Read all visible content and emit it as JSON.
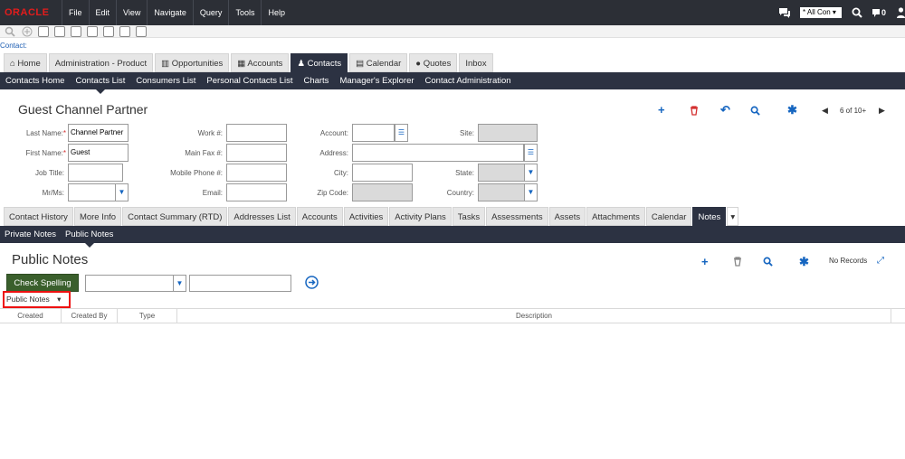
{
  "app": {
    "logo": "ORACLE",
    "menu": [
      "File",
      "Edit",
      "View",
      "Navigate",
      "Query",
      "Tools",
      "Help"
    ],
    "search_scope": "* All Con",
    "notification_count": "0"
  },
  "context_label": "Contact:",
  "screen_tabs": [
    {
      "label": "Home",
      "icon": "home-icon"
    },
    {
      "label": "Administration - Product"
    },
    {
      "label": "Opportunities",
      "icon": "bar-chart-icon"
    },
    {
      "label": "Accounts",
      "icon": "building-icon"
    },
    {
      "label": "Contacts",
      "icon": "person-icon",
      "active": true
    },
    {
      "label": "Calendar",
      "icon": "calendar-icon"
    },
    {
      "label": "Quotes",
      "icon": "quote-icon"
    },
    {
      "label": "Inbox"
    }
  ],
  "view_nav": [
    "Contacts Home",
    "Contacts List",
    "Consumers List",
    "Personal Contacts List",
    "Charts",
    "Manager's Explorer",
    "Contact Administration"
  ],
  "form": {
    "title": "Guest Channel Partner",
    "record_counter": "6 of 10+",
    "fields": {
      "last_name": {
        "label": "Last Name:",
        "value": "Channel Partner"
      },
      "first_name": {
        "label": "First Name:",
        "value": "Guest"
      },
      "job_title": {
        "label": "Job Title:",
        "value": ""
      },
      "mr_ms": {
        "label": "Mr/Ms:",
        "value": ""
      },
      "work_phone": {
        "label": "Work #:",
        "value": ""
      },
      "main_fax": {
        "label": "Main Fax #:",
        "value": ""
      },
      "mobile_phone": {
        "label": "Mobile Phone #:",
        "value": ""
      },
      "email": {
        "label": "Email:",
        "value": ""
      },
      "account": {
        "label": "Account:",
        "value": ""
      },
      "address": {
        "label": "Address:",
        "value": ""
      },
      "city": {
        "label": "City:",
        "value": ""
      },
      "zip_code": {
        "label": "Zip Code:",
        "value": ""
      },
      "site": {
        "label": "Site:",
        "value": ""
      },
      "state": {
        "label": "State:",
        "value": ""
      },
      "country": {
        "label": "Country:",
        "value": ""
      }
    }
  },
  "form_tabs": [
    "Contact History",
    "More Info",
    "Contact Summary (RTD)",
    "Addresses List",
    "Accounts",
    "Activities",
    "Activity Plans",
    "Tasks",
    "Assessments",
    "Assets",
    "Attachments",
    "Calendar",
    "Notes"
  ],
  "notes_nav": [
    "Private Notes",
    "Public Notes"
  ],
  "list": {
    "title": "Public Notes",
    "no_records": "No Records",
    "check_spelling": "Check Spelling",
    "notes_type": "Public Notes",
    "columns": [
      "Created",
      "Created By",
      "Type",
      "Description"
    ]
  }
}
